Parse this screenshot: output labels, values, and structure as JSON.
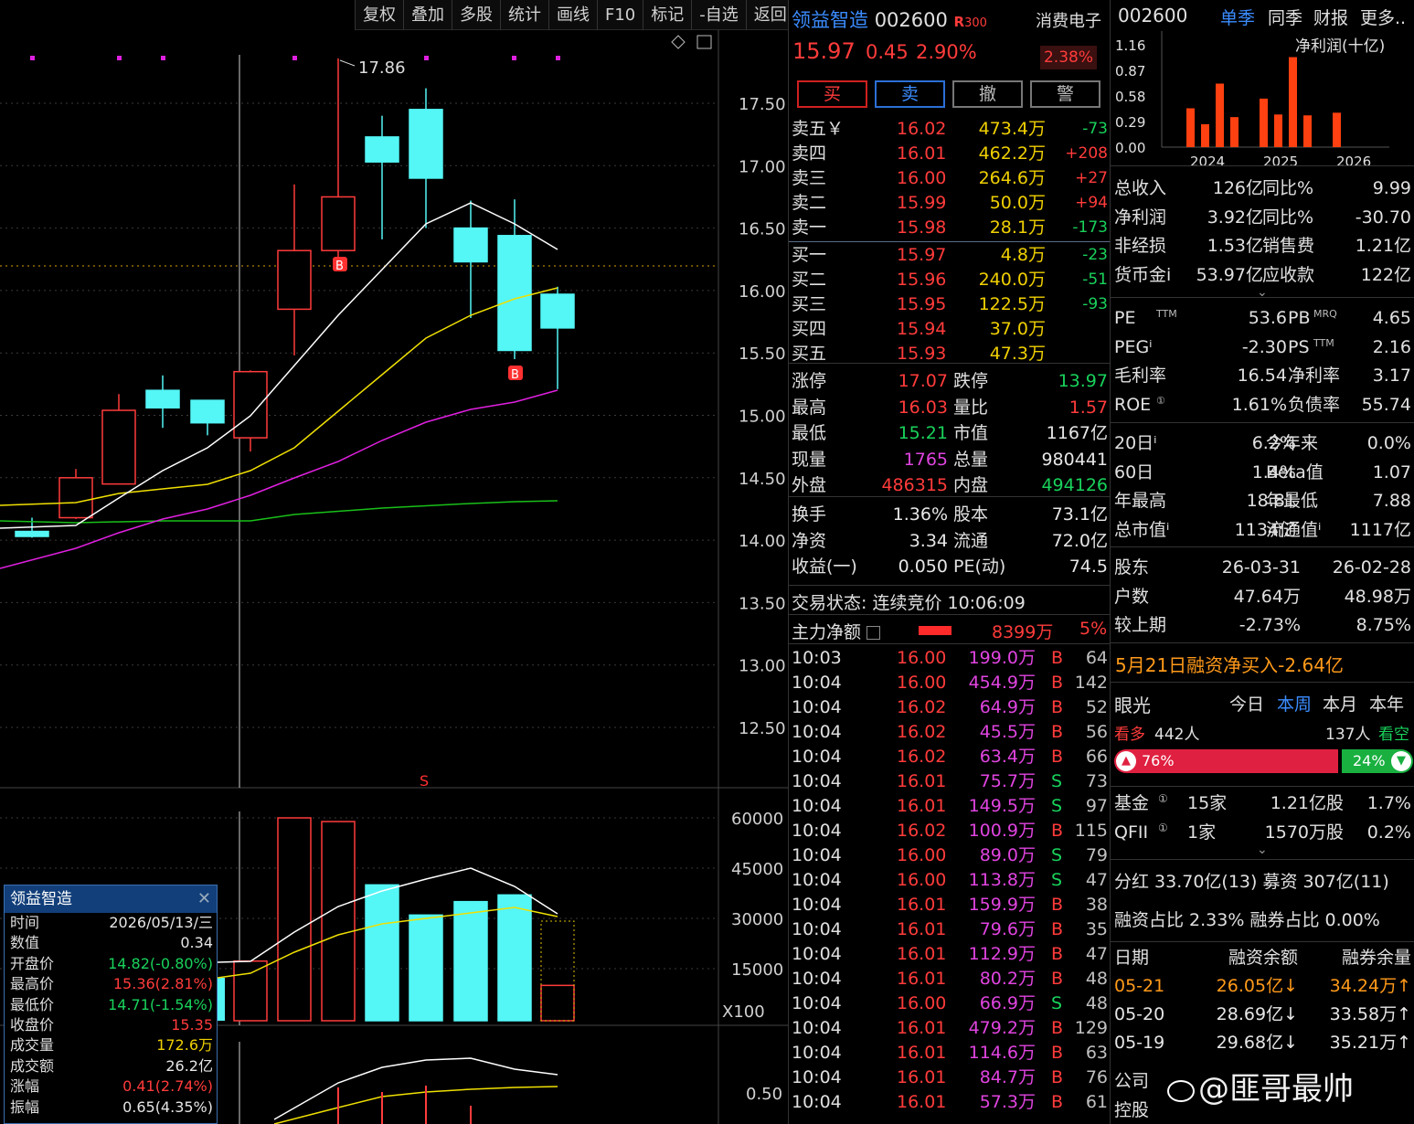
{
  "toolbar": [
    "复权",
    "叠加",
    "多股",
    "统计",
    "画线",
    "F10",
    "标记",
    "-自选",
    "返回"
  ],
  "kline": {
    "price_axis": [
      "17.50",
      "17.00",
      "16.50",
      "16.00",
      "15.50",
      "15.00",
      "14.50",
      "14.00",
      "13.50",
      "13.00",
      "12.50"
    ],
    "high_label": "17.86",
    "b_marker": "B",
    "s_marker": "S",
    "volume_axis": [
      "60000",
      "45000",
      "30000",
      "15000"
    ],
    "volume_unit": "X100",
    "indicator_axis": "0.50",
    "colors": {
      "up": "#ff3b3b",
      "down": "#54f6f6",
      "ma5": "#ffffff",
      "ma10": "#f0e000",
      "ma20": "#e020e0",
      "ma60": "#19c019"
    }
  },
  "popup": {
    "title": "领益智造",
    "rows": [
      {
        "label": "时间",
        "value": "2026/05/13/三",
        "color": "white"
      },
      {
        "label": "数值",
        "value": "0.34",
        "color": "white"
      },
      {
        "label": "开盘价",
        "value": "14.82(-0.80%)",
        "color": "green"
      },
      {
        "label": "最高价",
        "value": "15.36(2.81%)",
        "color": "red"
      },
      {
        "label": "最低价",
        "value": "14.71(-1.54%)",
        "color": "green"
      },
      {
        "label": "收盘价",
        "value": "15.35",
        "color": "red"
      },
      {
        "label": "成交量",
        "value": "172.6万",
        "color": "yellow"
      },
      {
        "label": "成交额",
        "value": "26.2亿",
        "color": "white"
      },
      {
        "label": "涨幅",
        "value": "0.41(2.74%)",
        "color": "red"
      },
      {
        "label": "振幅",
        "value": "0.65(4.35%)",
        "color": "white"
      }
    ]
  },
  "quote": {
    "name": "领益智造",
    "code": "002600",
    "tag": "R",
    "tag_num": "300",
    "sector": "消费电子",
    "sector_change": "2.38%",
    "price": "15.97",
    "change": "0.45",
    "change_pct": "2.90%",
    "buttons": [
      "买",
      "卖",
      "撤",
      "警"
    ],
    "asks": [
      {
        "label": "卖五￥",
        "price": "16.02",
        "vol": "473.4万",
        "delta": "-73",
        "dcolor": "green"
      },
      {
        "label": "卖四",
        "price": "16.01",
        "vol": "462.2万",
        "delta": "+208",
        "dcolor": "red"
      },
      {
        "label": "卖三",
        "price": "16.00",
        "vol": "264.6万",
        "delta": "+27",
        "dcolor": "red"
      },
      {
        "label": "卖二",
        "price": "15.99",
        "vol": "50.0万",
        "delta": "+94",
        "dcolor": "red"
      },
      {
        "label": "卖一",
        "price": "15.98",
        "vol": "28.1万",
        "delta": "-173",
        "dcolor": "green"
      }
    ],
    "bids": [
      {
        "label": "买一",
        "price": "15.97",
        "vol": "4.8万",
        "delta": "-23",
        "dcolor": "green"
      },
      {
        "label": "买二",
        "price": "15.96",
        "vol": "240.0万",
        "delta": "-51",
        "dcolor": "green"
      },
      {
        "label": "买三",
        "price": "15.95",
        "vol": "122.5万",
        "delta": "-93",
        "dcolor": "green"
      },
      {
        "label": "买四",
        "price": "15.94",
        "vol": "37.0万",
        "delta": "",
        "dcolor": "green"
      },
      {
        "label": "买五",
        "price": "15.93",
        "vol": "47.3万",
        "delta": "",
        "dcolor": "green"
      }
    ],
    "stats": [
      {
        "l1": "涨停",
        "v1": "17.07",
        "c1": "red",
        "l2": "跌停",
        "v2": "13.97",
        "c2": "green"
      },
      {
        "l1": "最高",
        "v1": "16.03",
        "c1": "red",
        "l2": "量比",
        "v2": "1.57",
        "c2": "red"
      },
      {
        "l1": "最低",
        "v1": "15.21",
        "c1": "green",
        "l2": "市值",
        "v2": "1167亿",
        "c2": "white"
      },
      {
        "l1": "现量",
        "v1": "1765",
        "c1": "magenta",
        "l2": "总量",
        "v2": "980441",
        "c2": "white"
      },
      {
        "l1": "外盘",
        "v1": "486315",
        "c1": "red",
        "l2": "内盘",
        "v2": "494126",
        "c2": "green"
      },
      {
        "l1": "换手",
        "v1": "1.36%",
        "c1": "white",
        "l2": "股本",
        "v2": "73.1亿",
        "c2": "white"
      },
      {
        "l1": "净资",
        "v1": "3.34",
        "c1": "white",
        "l2": "流通",
        "v2": "72.0亿",
        "c2": "white"
      },
      {
        "l1": "收益(一)",
        "v1": "0.050",
        "c1": "white",
        "l2": "PE(动)",
        "v2": "74.5",
        "c2": "white"
      }
    ],
    "trade_status": "交易状态: 连续竞价 10:06:09",
    "main_flow_label": "主力净额",
    "main_flow_value": "8399万",
    "main_flow_pct": "5%",
    "ticks": [
      {
        "t": "10:03",
        "p": "16.00",
        "v": "199.0万",
        "bs": "B",
        "n": "64"
      },
      {
        "t": "10:04",
        "p": "16.00",
        "v": "454.9万",
        "bs": "B",
        "n": "142"
      },
      {
        "t": "10:04",
        "p": "16.02",
        "v": "64.9万",
        "bs": "B",
        "n": "52"
      },
      {
        "t": "10:04",
        "p": "16.02",
        "v": "45.5万",
        "bs": "B",
        "n": "56"
      },
      {
        "t": "10:04",
        "p": "16.02",
        "v": "63.4万",
        "bs": "B",
        "n": "66"
      },
      {
        "t": "10:04",
        "p": "16.01",
        "v": "75.7万",
        "bs": "S",
        "n": "73"
      },
      {
        "t": "10:04",
        "p": "16.01",
        "v": "149.5万",
        "bs": "S",
        "n": "97"
      },
      {
        "t": "10:04",
        "p": "16.02",
        "v": "100.9万",
        "bs": "B",
        "n": "115"
      },
      {
        "t": "10:04",
        "p": "16.00",
        "v": "89.0万",
        "bs": "S",
        "n": "79"
      },
      {
        "t": "10:04",
        "p": "16.00",
        "v": "113.8万",
        "bs": "S",
        "n": "47"
      },
      {
        "t": "10:04",
        "p": "16.01",
        "v": "159.9万",
        "bs": "B",
        "n": "38"
      },
      {
        "t": "10:04",
        "p": "16.01",
        "v": "79.6万",
        "bs": "B",
        "n": "35"
      },
      {
        "t": "10:04",
        "p": "16.01",
        "v": "112.9万",
        "bs": "B",
        "n": "47"
      },
      {
        "t": "10:04",
        "p": "16.01",
        "v": "80.2万",
        "bs": "B",
        "n": "48"
      },
      {
        "t": "10:04",
        "p": "16.00",
        "v": "66.9万",
        "bs": "S",
        "n": "48"
      },
      {
        "t": "10:04",
        "p": "16.01",
        "v": "479.2万",
        "bs": "B",
        "n": "129"
      },
      {
        "t": "10:04",
        "p": "16.01",
        "v": "114.6万",
        "bs": "B",
        "n": "63"
      },
      {
        "t": "10:04",
        "p": "16.01",
        "v": "84.7万",
        "bs": "B",
        "n": "76"
      },
      {
        "t": "10:04",
        "p": "16.01",
        "v": "57.3万",
        "bs": "B",
        "n": "61"
      }
    ]
  },
  "right": {
    "code": "002600",
    "tabs": [
      "单季",
      "同季",
      "财报",
      "更多.."
    ],
    "profit_chart": {
      "title": "净利润(十亿)",
      "y_ticks": [
        "1.16",
        "0.87",
        "0.58",
        "0.29",
        "0.00"
      ],
      "x_labels": [
        "2024",
        "2025",
        "2026"
      ],
      "bars": [
        0.44,
        0.26,
        0.72,
        0.34,
        0.0,
        0.55,
        0.37,
        1.02,
        0.36,
        0.0,
        0.39
      ]
    },
    "fin": [
      {
        "l1": "总收入",
        "v1": "126亿",
        "l2": "同比%",
        "v2": "9.99"
      },
      {
        "l1": "净利润",
        "v1": "3.92亿",
        "l2": "同比%",
        "v2": "-30.70"
      },
      {
        "l1": "非经损",
        "v1": "1.53亿",
        "l2": "销售费",
        "v2": "1.21亿"
      },
      {
        "l1": "货币金i",
        "v1": "53.97亿",
        "l2": "应收款",
        "v2": "122亿"
      }
    ],
    "valuation": [
      {
        "l1": "PE",
        "s1": "TTM",
        "v1": "53.6",
        "l2": "PB",
        "s2": "MRQ",
        "v2": "4.65"
      },
      {
        "l1": "PEGⁱ",
        "s1": "",
        "v1": "-2.30",
        "l2": "PS",
        "s2": "TTM",
        "v2": "2.16"
      },
      {
        "l1": "毛利率",
        "s1": "",
        "v1": "16.54",
        "l2": "净利率",
        "s2": "",
        "v2": "3.17"
      },
      {
        "l1": "ROE",
        "s1": "①",
        "v1": "1.61%",
        "l2": "负债率",
        "s2": "",
        "v2": "55.74"
      }
    ],
    "perf": [
      {
        "l1": "20日ⁱ",
        "v1": "6.2%",
        "l2": "今年来",
        "v2": "0.0%"
      },
      {
        "l1": "60日",
        "v1": "1.4%",
        "l2": "Beta值",
        "v2": "1.07"
      },
      {
        "l1": "年最高",
        "v1": "18.81",
        "l2": "年最低",
        "v2": "7.88"
      },
      {
        "l1": "总市值ⁱ",
        "v1": "1134亿",
        "l2": "流通值ⁱ",
        "v2": "1117亿"
      }
    ],
    "holders": [
      {
        "l": "股东",
        "a": "26-03-31",
        "b": "26-02-28",
        "ca": "white",
        "cb": "white"
      },
      {
        "l": "户数",
        "a": "47.64万",
        "b": "48.98万",
        "ca": "white",
        "cb": "white"
      },
      {
        "l": "较上期",
        "a": "-2.73%",
        "b": "8.75%",
        "ca": "white",
        "cb": "white"
      }
    ],
    "margin_news": "5月21日融资净买入-2.64亿",
    "vision": {
      "title": "眼光",
      "tabs": [
        "今日",
        "本周",
        "本月",
        "本年"
      ],
      "bull_label": "看多",
      "bull_count": "442人",
      "bear_count": "137人",
      "bear_label": "看空",
      "bull_pct": "76%",
      "bear_pct": "24%",
      "bull_ratio": 0.76
    },
    "inst": [
      {
        "l": "基金",
        "s": "①",
        "a": "15家",
        "b": "1.21亿股",
        "c": "1.7%"
      },
      {
        "l": "QFII",
        "s": "①",
        "a": "1家",
        "b": "1570万股",
        "c": "0.2%"
      }
    ],
    "dividend": "分红 33.70亿(13) 募资 307亿(11)",
    "ratio": "融资占比 2.33% 融券占比 0.00%",
    "margin_head": [
      "日期",
      "融资余额",
      "融券余量"
    ],
    "margin_rows": [
      {
        "d": "05-21",
        "a": "26.05亿↓",
        "b": "34.24万↑",
        "color": "orange"
      },
      {
        "d": "05-20",
        "a": "28.69亿↓",
        "b": "33.58万↑",
        "color": "white"
      },
      {
        "d": "05-19",
        "a": "29.68亿↓",
        "b": "35.21万↑",
        "color": "white"
      }
    ],
    "company_label": "公司",
    "control_label": "控股",
    "watermark": "@匪哥最帅"
  }
}
